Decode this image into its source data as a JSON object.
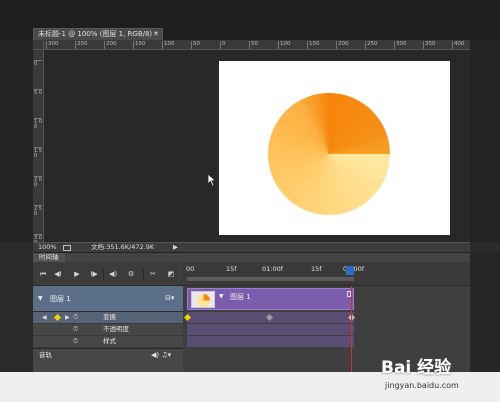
{
  "document": {
    "tab_title": "未标题-1 @ 100% (图层 1, RGB/8) *",
    "close_glyph": "×"
  },
  "ruler": {
    "h_ticks": [
      "300",
      "250",
      "200",
      "150",
      "100",
      "50",
      "0",
      "50",
      "100",
      "150",
      "200",
      "250",
      "300",
      "350",
      "400"
    ],
    "v_ticks": [
      "0",
      "5 0",
      "1 0 0",
      "1 5 0",
      "2 0 0",
      "2 5 0",
      "3 0 0"
    ]
  },
  "status": {
    "zoom": "100%",
    "doc_info": "文档:351.6K/472.9K",
    "arrow": "▶"
  },
  "timeline": {
    "panel_tab": "时间轴",
    "time_marks": [
      "00",
      "15f",
      "01:00f",
      "15f",
      "02:00f"
    ],
    "layer": {
      "name": "图层 1",
      "clip_name": "图层 1"
    },
    "properties": [
      {
        "label": "变换",
        "selected": true
      },
      {
        "label": "不透明度",
        "selected": false
      },
      {
        "label": "样式",
        "selected": false
      }
    ],
    "audio_label": "音轨",
    "colors": {
      "clip": "#7c5cad",
      "playhead": "#d03030",
      "keyframe_start": "#f5d000",
      "keyframe_mid": "#9a9a9a"
    }
  },
  "watermark": {
    "brand": "Bai 经验",
    "url": "jingyan.baidu.com"
  },
  "canvas_colors": {
    "slice_dark": "#f6850a",
    "slice_light": "#ffe39a"
  }
}
